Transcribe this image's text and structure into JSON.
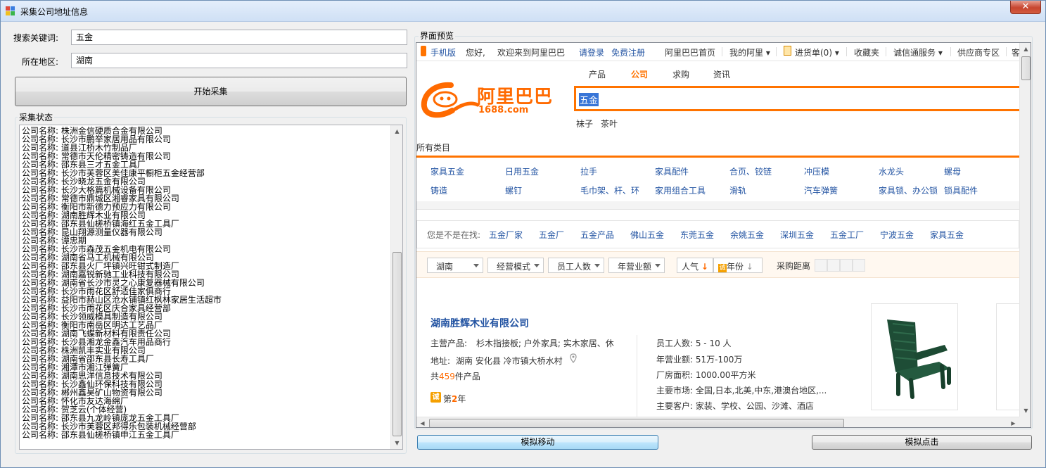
{
  "window": {
    "title": "采集公司地址信息",
    "close_glyph": "✕"
  },
  "form": {
    "keyword_label": "搜索关键词:",
    "keyword_value": "五金",
    "region_label": "所在地区:",
    "region_value": "湖南",
    "start_button": "开始采集"
  },
  "status": {
    "title": "采集状态",
    "lines": [
      "公司名称: 株洲金信硬质合金有限公司",
      "公司名称: 长沙市鹏举家居用品有限公司",
      "公司名称: 道县江桥木竹制品厂",
      "公司名称: 常德市天伦精密铸造有限公司",
      "公司名称: 邵东县三才五金工具厂",
      "公司名称: 长沙市芙蓉区美佳康平橱柜五金经营部",
      "公司名称: 长沙晓龙五金有限公司",
      "公司名称: 长沙大格篇机械设备有限公司",
      "公司名称: 常德市鼎城区湘睿家具有限公司",
      "公司名称: 衡阳市新德力预应力有限公司",
      "公司名称: 湖南胜辉木业有限公司",
      "公司名称: 邵东县仙槎桥镇海红五金工具厂",
      "公司名称: 昆山翔源测量仪器有限公司",
      "公司名称: 谭忠期",
      "公司名称: 长沙市森茂五金机电有限公司",
      "公司名称: 湖南省马工机械有限公司",
      "公司名称: 邵东县火厂坪镇兴旺钳式制造厂",
      "公司名称: 湖南嘉锐新驰工业科技有限公司",
      "公司名称: 湖南省长沙市灵之心康复器械有限公司",
      "公司名称: 长沙市雨花区舒适佳家俱商行",
      "公司名称: 益阳市赫山区沧水铺镇红枫林家居生活超市",
      "公司名称: 长沙市雨花区庆合家具经营部",
      "公司名称: 长沙领威模具制造有限公司",
      "公司名称: 衡阳市南岳区明达工艺品厂",
      "公司名称: 湖南飞蝶新材料有限责任公司",
      "公司名称: 长沙县湘龙金鑫汽车用品商行",
      "公司名称: 株洲凯丰实业有限公司",
      "公司名称: 湖南省邵东县长寿工具厂",
      "公司名称: 湘潭市湘江弹簧厂",
      "公司名称: 湖南思洋信息技术有限公司",
      "公司名称: 长沙鑫仙环保科技有限公司",
      "公司名称: 郴州鑫昊矿山物资有限公司",
      "公司名称: 怀化市友达海绵厂",
      "公司名称: 贺芝云(个体经营)",
      "公司名称: 邵东县九龙岭镇庞龙五金工具厂",
      "公司名称: 长沙市芙蓉区邦得乐包装机械经营部",
      "公司名称: 邵东县仙槎桥镇申江五金工具厂"
    ]
  },
  "preview": {
    "title": "界面预览",
    "topbar": {
      "mobile": "手机版",
      "hello": "您好,",
      "welcome": "欢迎来到阿里巴巴",
      "login": "请登录",
      "register": "免费注册",
      "home": "阿里巴巴首页",
      "my_ali": "我的阿里",
      "cart": "进货单(0)",
      "favorites": "收藏夹",
      "chengxin": "诚信通服务",
      "supplier": "供应商专区",
      "more": "客"
    },
    "tabs": [
      "产品",
      "公司",
      "求购",
      "资讯"
    ],
    "logo": {
      "cn": "阿里巴巴",
      "site": "1688.com"
    },
    "search_value": "五金",
    "hotwords": [
      "袜子",
      "茶叶"
    ],
    "all_categories": "所有类目",
    "categories_row1": [
      "家具五金",
      "日用五金",
      "拉手",
      "家具配件",
      "合页、铰链",
      "冲压模",
      "水龙头",
      "螺母"
    ],
    "categories_row2": [
      "铸造",
      "螺钉",
      "毛巾架、杆、环",
      "家用组合工具",
      "滑轨",
      "汽车弹簧",
      "家具锁、办公锁",
      "锁具配件"
    ],
    "related_label": "您是不是在找:",
    "related": [
      "五金厂家",
      "五金厂",
      "五金产品",
      "佛山五金",
      "东莞五金",
      "余姚五金",
      "深圳五金",
      "五金工厂",
      "宁波五金",
      "家具五金"
    ],
    "filters": {
      "region": "湖南",
      "mode": "经营模式",
      "staff": "员工人数",
      "revenue": "年营业额",
      "popularity": "人气",
      "years": "年份",
      "distance": "采购距离"
    },
    "company": {
      "name": "湖南胜辉木业有限公司",
      "main_label": "主营产品:",
      "main_products": "杉木指接板; 户外家具; 实木家居、休",
      "address_label": "地址:",
      "address": "湖南  安化县  冷市镇大桥水村",
      "product_prefix": "共",
      "product_count": "459",
      "product_suffix": "件产品",
      "badge": "诚",
      "years_prefix": "第",
      "years_value": "2",
      "years_suffix": "年",
      "staff": "员工人数: 5 - 10 人",
      "revenue": "年营业额: 51万-100万",
      "area": "厂房面积: 1000.00平方米",
      "markets": "主要市场: 全国,日本,北美,中东,港澳台地区,...",
      "customers": "主要客户: 家装、学校、公园、沙滩、酒店"
    }
  },
  "buttons": {
    "simulate_move": "模拟移动",
    "simulate_click": "模拟点击"
  },
  "icons": {
    "mobile": "mobile-phone-icon",
    "cart": "clipboard-icon",
    "location": "location-pin-icon",
    "sort_down": "down-arrow-icon"
  },
  "colors": {
    "brand_orange": "#ff7300",
    "link_blue": "#2253a2",
    "selection_blue": "#3875d7",
    "title_close_red": "#c7452f"
  }
}
